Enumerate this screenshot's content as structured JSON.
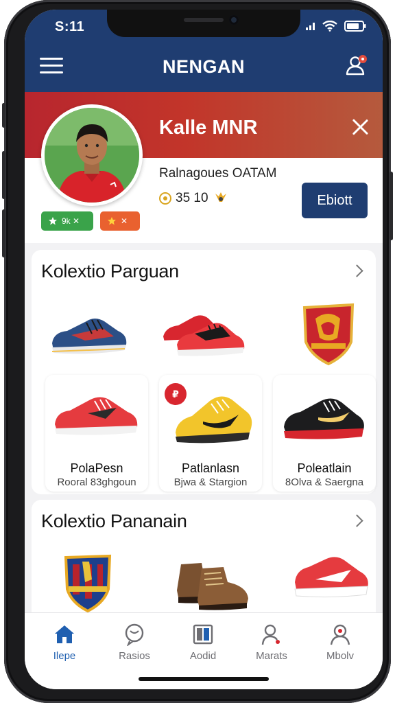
{
  "status_bar": {
    "time": "S:11"
  },
  "app_bar": {
    "title": "NENGAN",
    "menu_icon": "hamburger-menu-icon",
    "notification_icon": "user-notification-icon"
  },
  "colors": {
    "primary": "#1f3d71",
    "accent_red": "#c2352a",
    "badge_green": "#3aa34a",
    "badge_orange": "#e9612f",
    "active_nav": "#1f5fb0"
  },
  "profile": {
    "name": "Kalle MNR",
    "subtitle": "Ralnagoues OATAM",
    "points": "35 10",
    "edit_label": "Ebiott",
    "badges": [
      {
        "label": "9k ✕"
      },
      {
        "label": "✕"
      }
    ]
  },
  "sections": [
    {
      "title": "Kolextio Parguan",
      "items": [
        {
          "name": "blue-sneaker"
        },
        {
          "name": "red-black-sneakers"
        },
        {
          "name": "club-crest-red"
        },
        {
          "name": "red-shoe",
          "label": "PolaPesn",
          "sub": "Rooral 83ghgoun"
        },
        {
          "name": "yellow-shoe",
          "label": "Patlanlasn",
          "sub": "Bjwa & Stargion"
        },
        {
          "name": "black-shoe",
          "label": "Poleatlain",
          "sub": "8Olva & Saergna"
        }
      ]
    },
    {
      "title": "Kolextio Pananain",
      "items": [
        {
          "name": "club-crest-blue"
        },
        {
          "name": "brown-boots"
        },
        {
          "name": "red-white-sneaker"
        }
      ]
    }
  ],
  "bottom_nav": [
    {
      "label": "Ilepe",
      "icon": "home-icon",
      "active": true
    },
    {
      "label": "Rasios",
      "icon": "chat-icon",
      "active": false
    },
    {
      "label": "Aodid",
      "icon": "book-icon",
      "active": false
    },
    {
      "label": "Marats",
      "icon": "person-search-icon",
      "active": false
    },
    {
      "label": "Mbolv",
      "icon": "profile-icon",
      "active": false
    }
  ]
}
